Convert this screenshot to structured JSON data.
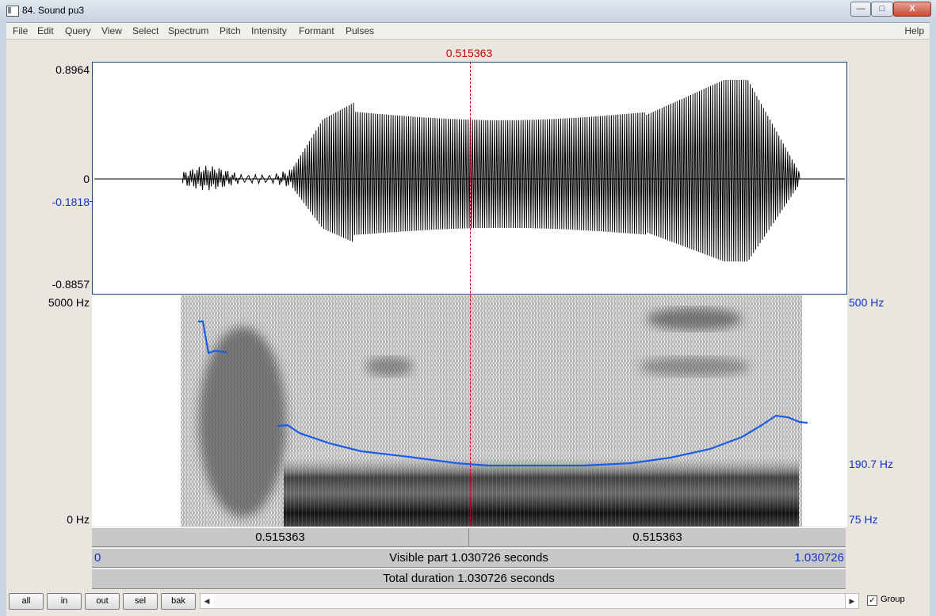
{
  "window": {
    "title": "84. Sound pu3",
    "minimize": "—",
    "maximize": "□",
    "close": "X"
  },
  "menu": [
    "File",
    "Edit",
    "Query",
    "View",
    "Select",
    "Spectrum",
    "Pitch",
    "Intensity",
    "Formant",
    "Pulses"
  ],
  "help": "Help",
  "cursor_time": "0.515363",
  "sound": {
    "ymax": "0.8964",
    "zero": "0",
    "cursor_value": "-0.1818",
    "ymin": "-0.8857"
  },
  "spectrogram": {
    "fmax": "5000 Hz",
    "fmin": "0 Hz"
  },
  "pitch": {
    "top": "500 Hz",
    "mid": "190.7 Hz",
    "bottom": "75 Hz"
  },
  "bars": {
    "left_segment": "0.515363",
    "right_segment": "0.515363",
    "visible_start": "0",
    "visible_label": "Visible part 1.030726 seconds",
    "visible_end": "1.030726",
    "total_label": "Total duration 1.030726 seconds"
  },
  "buttons": [
    "all",
    "in",
    "out",
    "sel",
    "bak"
  ],
  "group": {
    "label": "Group",
    "checked": true,
    "mark": "✓"
  },
  "colors": {
    "cursor": "#cc0000",
    "pitch": "#1530c8"
  }
}
